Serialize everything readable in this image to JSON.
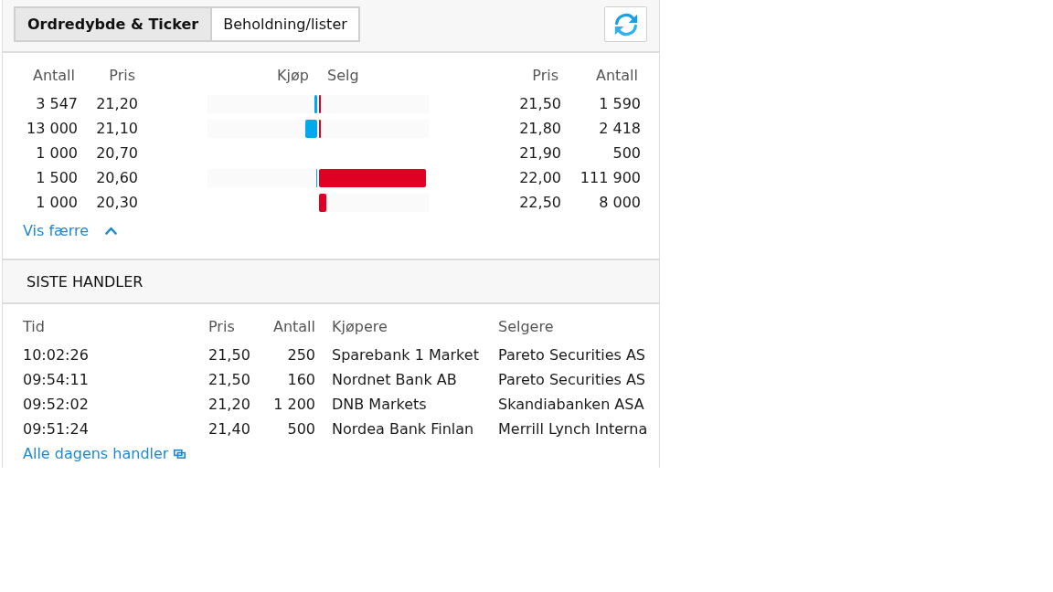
{
  "tabs": [
    {
      "label": "Ordredybde & Ticker",
      "selected": true
    },
    {
      "label": "Beholdning/lister",
      "selected": false
    }
  ],
  "order_depth": {
    "columns": [
      "Antall",
      "Pris",
      "Kjøp",
      "Selg",
      "Pris",
      "Antall"
    ],
    "rows": [
      {
        "bid_quantity": "3 547",
        "bid_price": "21,20",
        "buy_bar": {
          "level": 0.025
        },
        "sell_bar": {
          "level": 0.02
        },
        "ask_price": "21,50",
        "ask_quantity": "1 590"
      },
      {
        "bid_quantity": "13 000",
        "bid_price": "21,10",
        "buy_bar": {
          "level": 0.11
        },
        "sell_bar": {
          "level": 0.02
        },
        "ask_price": "21,80",
        "ask_quantity": "2 418"
      },
      {
        "bid_quantity": "1 000",
        "bid_price": "20,70",
        "ask_price": "21,90",
        "ask_quantity": "500"
      },
      {
        "bid_quantity": "1 500",
        "bid_price": "20,60",
        "buy_bar": {
          "level": 0.01
        },
        "sell_bar": {
          "level": 0.975
        },
        "ask_price": "22,00",
        "ask_quantity": "111 900"
      },
      {
        "bid_quantity": "1 000",
        "bid_price": "20,30",
        "sell_bar": {
          "level": 0.07
        },
        "ask_price": "22,50",
        "ask_quantity": "8 000"
      }
    ],
    "toggle_link": "Vis færre"
  },
  "recent_trades": {
    "title": "SISTE HANDLER",
    "columns": [
      "Tid",
      "Pris",
      "Antall",
      "Kjøpere",
      "Selgere"
    ],
    "rows": [
      {
        "time": "10:02:26",
        "price": "21,50",
        "quantity": "250",
        "buyer": "Sparebank 1 Market",
        "seller": "Pareto Securities AS"
      },
      {
        "time": "09:54:11",
        "price": "21,50",
        "quantity": "160",
        "buyer": "Nordnet Bank AB",
        "seller": "Pareto Securities AS"
      },
      {
        "time": "09:52:02",
        "price": "21,20",
        "quantity": "1 200",
        "buyer": "DNB Markets",
        "seller": "Skandiabanken ASA"
      },
      {
        "time": "09:51:24",
        "price": "21,40",
        "quantity": "500",
        "buyer": "Nordea Bank Finlan",
        "seller": "Merrill Lynch Interna"
      }
    ],
    "all_trades_link": "Alle dagens handler"
  }
}
